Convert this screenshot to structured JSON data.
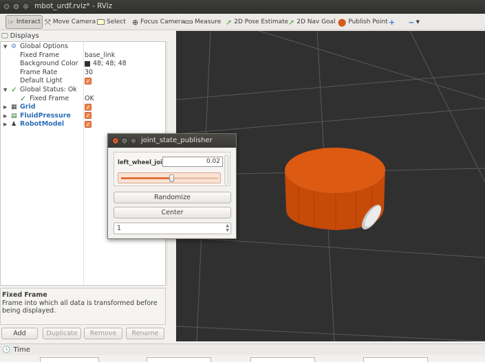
{
  "window": {
    "title": "mbot_urdf.rviz* - RViz"
  },
  "toolbar": {
    "tools": [
      {
        "label": "Interact",
        "icon": "interact-icon"
      },
      {
        "label": "Move Camera",
        "icon": "move-camera-icon"
      },
      {
        "label": "Select",
        "icon": "select-icon"
      },
      {
        "label": "Focus Camera",
        "icon": "focus-camera-icon"
      },
      {
        "label": "Measure",
        "icon": "measure-icon"
      },
      {
        "label": "2D Pose Estimate",
        "icon": "pose-arrow-icon"
      },
      {
        "label": "2D Nav Goal",
        "icon": "nav-goal-arrow-icon"
      },
      {
        "label": "Publish Point",
        "icon": "map-pin-icon"
      }
    ],
    "active_tool": "Interact"
  },
  "displays": {
    "header": "Displays",
    "rows": [
      {
        "label": "Global Options"
      },
      {
        "label": "Fixed Frame",
        "value": "base_link"
      },
      {
        "label": "Background Color",
        "value": "48; 48; 48"
      },
      {
        "label": "Frame Rate",
        "value": "30"
      },
      {
        "label": "Default Light"
      },
      {
        "label": "Global Status: Ok"
      },
      {
        "label": "Fixed Frame",
        "value": "OK"
      },
      {
        "label": "Grid"
      },
      {
        "label": "FluidPressure"
      },
      {
        "label": "RobotModel"
      }
    ],
    "check_mark": "✓"
  },
  "description": {
    "title": "Fixed Frame",
    "text": "Frame into which all data is transformed before being displayed."
  },
  "buttons": {
    "add": "Add",
    "duplicate": "Duplicate",
    "remove": "Remove",
    "rename": "Rename"
  },
  "time_panel": {
    "title": "Time"
  },
  "joint_state_publisher": {
    "title": "joint_state_publisher",
    "joint_name": "left_wheel_joint",
    "joint_value": "0.02",
    "slider_fraction": 0.52,
    "randomize": "Randomize",
    "center": "Center",
    "spin_value": "1"
  },
  "colors": {
    "viewport_bg": "#303030",
    "robot_body": "#d4520c",
    "accent_orange": "#f0874e"
  }
}
